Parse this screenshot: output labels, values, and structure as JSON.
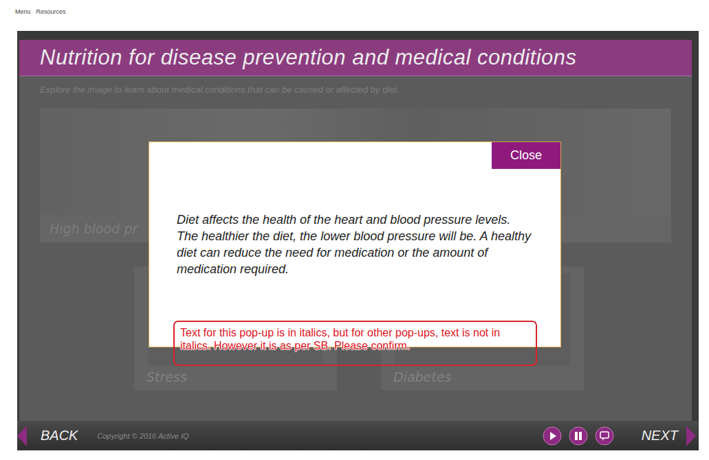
{
  "top_menu": [
    "Menu",
    "Resources"
  ],
  "page": {
    "title": "Nutrition for disease prevention and medical conditions",
    "instruction": "Explore the image to learn about medical conditions that can be caused or affected by diet."
  },
  "top_tile": {
    "label": "High blood pr"
  },
  "bottom_tiles": [
    {
      "label": "Stress"
    },
    {
      "label": "Diabetes"
    }
  ],
  "popup": {
    "close": "Close",
    "text": "Diet affects the health of the heart and blood pressure levels. The healthier the diet, the lower blood pressure will be. A healthy diet can reduce the need for medication or the amount of medication required."
  },
  "annotation": "Text for this pop-up is in italics, but for other pop-ups, text is not in italics. However it is as per SB. Please confirm.",
  "footer": {
    "back": "BACK",
    "copyright": "Copyright © 2016 Active IQ",
    "next": "NEXT"
  }
}
